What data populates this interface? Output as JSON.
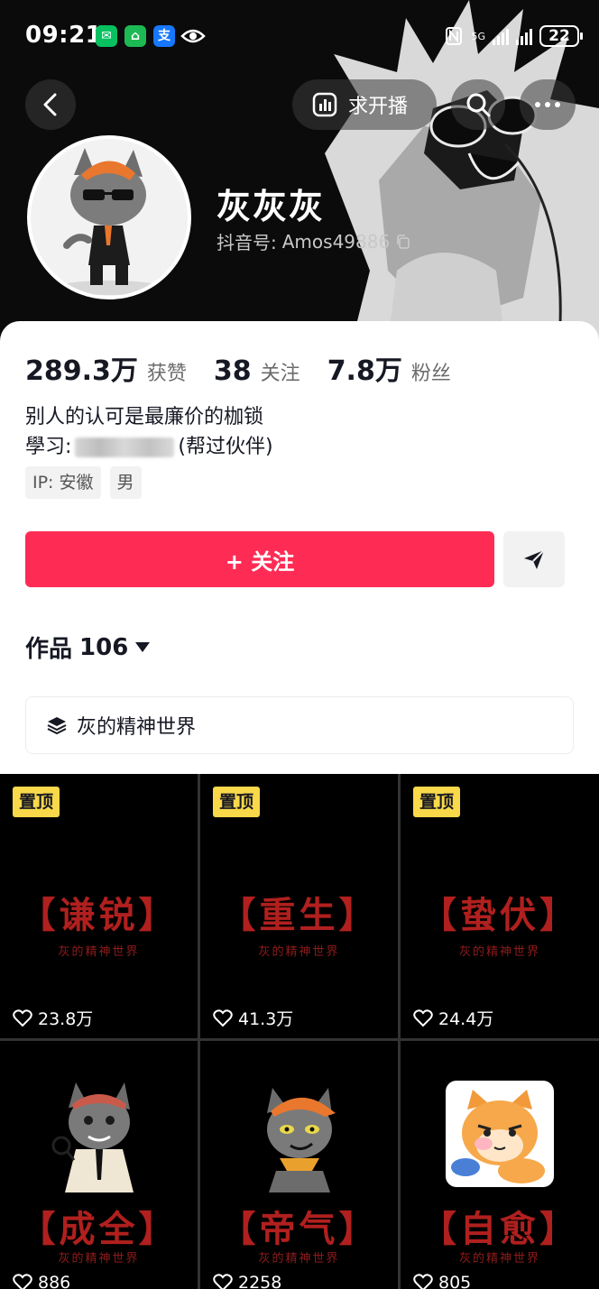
{
  "status_bar": {
    "time": "09:21",
    "network": "5G",
    "battery": "22"
  },
  "header": {
    "request_live_label": "求开播"
  },
  "profile": {
    "nickname": "灰灰灰",
    "douyin_id_label": "抖音号:",
    "douyin_id": "Amos49886",
    "stats": [
      {
        "value": "289.3万",
        "label": "获赞"
      },
      {
        "value": "38",
        "label": "关注"
      },
      {
        "value": "7.8万",
        "label": "粉丝"
      }
    ],
    "bio_line1": "别人的认可是最廉价的枷锁",
    "bio_line2_prefix": "學习:",
    "bio_line2_suffix": "(帮过伙伴)",
    "tags": [
      "IP: 安徽",
      "男"
    ]
  },
  "actions": {
    "follow_label": "+ 关注"
  },
  "works": {
    "label": "作品",
    "count": "106"
  },
  "collection": {
    "name": "灰的精神世界"
  },
  "videos": [
    {
      "pin": "置顶",
      "title": "【谦锐】",
      "subtitle": "灰的精神世界",
      "likes": "23.8万",
      "thumb": "none"
    },
    {
      "pin": "置顶",
      "title": "【重生】",
      "subtitle": "灰的精神世界",
      "likes": "41.3万",
      "thumb": "none"
    },
    {
      "pin": "置顶",
      "title": "【蛰伏】",
      "subtitle": "灰的精神世界",
      "likes": "24.4万",
      "thumb": "none"
    },
    {
      "pin": "",
      "title": "【成全】",
      "subtitle": "灰的精神世界",
      "likes": "886",
      "thumb": "wolf-suit"
    },
    {
      "pin": "",
      "title": "【帝气】",
      "subtitle": "灰的精神世界",
      "likes": "2258",
      "thumb": "wolf-cap"
    },
    {
      "pin": "",
      "title": "【自愈】",
      "subtitle": "灰的精神世界",
      "likes": "805",
      "thumb": "orange-cat"
    }
  ],
  "colors": {
    "accent": "#fe2c55",
    "pin": "#f9d84a",
    "video_title": "#b0201e"
  }
}
